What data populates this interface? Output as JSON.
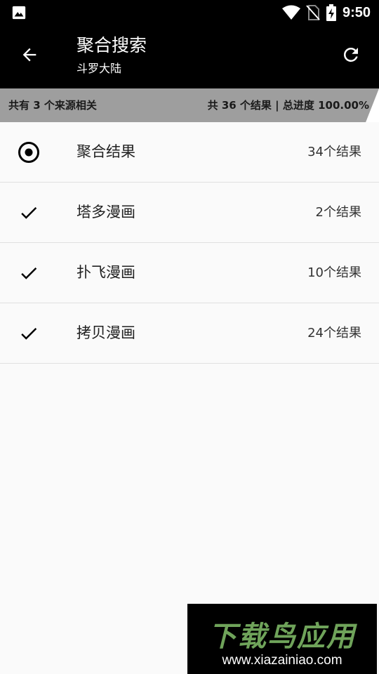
{
  "status_bar": {
    "time": "9:50",
    "icons": [
      "image-icon",
      "wifi-icon",
      "no-sim-icon",
      "battery-charging-icon"
    ]
  },
  "app_bar": {
    "title": "聚合搜索",
    "subtitle": "斗罗大陆",
    "back_icon": "arrow-back-icon",
    "refresh_icon": "refresh-icon"
  },
  "summary": {
    "left_text": "共有 3 个来源相关",
    "right_text": "共 36 个结果 | 总进度 100.00%",
    "progress_percent": 100,
    "fill_color": "#9e9e9e"
  },
  "sources": [
    {
      "name": "聚合结果",
      "count": "34个结果",
      "icon": "radio-selected-icon"
    },
    {
      "name": "塔多漫画",
      "count": "2个结果",
      "icon": "check-icon"
    },
    {
      "name": "扑飞漫画",
      "count": "10个结果",
      "icon": "check-icon"
    },
    {
      "name": "拷贝漫画",
      "count": "24个结果",
      "icon": "check-icon"
    }
  ],
  "watermark": {
    "brand": "下载鸟应用",
    "url": "www.xiazainiao.com",
    "brand_color": "#6fa35a"
  }
}
